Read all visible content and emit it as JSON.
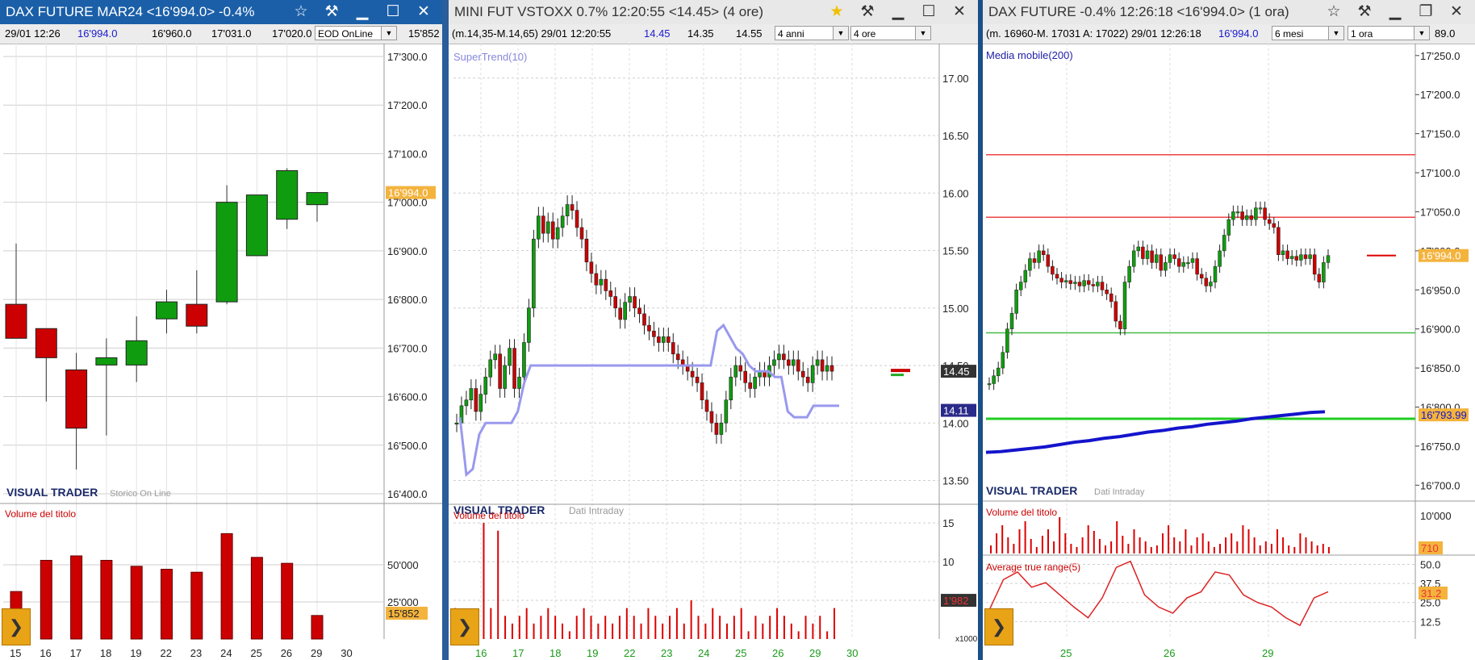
{
  "colors": {
    "up": "#0f9d0f",
    "down": "#cc0000",
    "supertrend": "#9999ee",
    "ma200": "#1414cc",
    "grid": "#cfcfcf",
    "price_tag": "#f3b33d"
  },
  "left": {
    "title": "DAX FUTURE MAR24 <16'994.0> -0.4%",
    "info": {
      "date": "29/01 12:26",
      "last": "16'994.0",
      "v1": "16'960.0",
      "v2": "17'031.0",
      "v3": "17'020.0",
      "source": "EOD OnLine",
      "volume": "15'852"
    },
    "watermark": "VISUAL TRADER",
    "watermark_sub": "Storico On Line",
    "volume_label": "Volume del titolo",
    "price_tag": "16'994.0",
    "volume_tag": "15'852",
    "y_ticks": [
      "17'300.0",
      "17'200.0",
      "17'100.0",
      "17'000.0",
      "16'900.0",
      "16'800.0",
      "16'700.0",
      "16'600.0",
      "16'500.0",
      "16'400.0"
    ],
    "vol_ticks": [
      "50'000",
      "25'000"
    ],
    "x_labels": [
      "15",
      "16",
      "17",
      "18",
      "19",
      "22",
      "23",
      "24",
      "25",
      "26",
      "29",
      "30"
    ],
    "chart_data": {
      "type": "candlestick",
      "categories": [
        "15",
        "16",
        "17",
        "18",
        "19",
        "22",
        "23",
        "24",
        "25",
        "26",
        "29"
      ],
      "open": [
        16790,
        16740,
        16655,
        16665,
        16665,
        16760,
        16790,
        16795,
        16890,
        16965,
        16995
      ],
      "close": [
        16720,
        16680,
        16535,
        16680,
        16715,
        16795,
        16745,
        17000,
        17015,
        17065,
        17020
      ],
      "high": [
        16915,
        16740,
        16690,
        16720,
        16765,
        16820,
        16860,
        17035,
        17015,
        17070,
        17020
      ],
      "low": [
        16720,
        16590,
        16450,
        16520,
        16630,
        16730,
        16730,
        16790,
        16890,
        16945,
        16960
      ],
      "volume": [
        32000,
        53000,
        56000,
        53000,
        49000,
        47000,
        45000,
        71000,
        55000,
        51000,
        15852
      ],
      "ylim": [
        16400,
        17300
      ]
    }
  },
  "middle": {
    "title": "MINI FUT VSTOXX 0.7% 12:20:55 <14.45> (4 ore)",
    "info": {
      "range": "(m.14,35-M.14,65) 29/01 12:20:55",
      "last": "14.45",
      "v1": "14.35",
      "v2": "14.55",
      "period": "4 anni",
      "interval": "4 ore"
    },
    "indicator": "SuperTrend(10)",
    "watermark": "VISUAL TRADER",
    "watermark_sub": "Dati Intraday",
    "volume_label": "Volume del titolo",
    "price_tag": "14.45",
    "st_tag": "14.11",
    "vol_tag": "1'982",
    "vol_unit": "x1000",
    "y_ticks": [
      "17.00",
      "16.50",
      "16.00",
      "15.50",
      "15.00",
      "14.50",
      "14.00",
      "13.50"
    ],
    "vol_ticks": [
      "15",
      "10",
      "5"
    ],
    "x_labels": [
      "16",
      "17",
      "18",
      "19",
      "22",
      "23",
      "24",
      "25",
      "26",
      "29",
      "30"
    ],
    "chart_data": {
      "type": "candlestick",
      "series": [
        {
          "name": "SuperTrend(10)"
        }
      ],
      "close": [
        14.0,
        14.15,
        14.2,
        14.3,
        14.1,
        14.25,
        14.4,
        14.55,
        14.6,
        14.3,
        14.5,
        14.65,
        14.3,
        14.4,
        14.7,
        15.0,
        15.6,
        15.8,
        15.65,
        15.75,
        15.6,
        15.7,
        15.8,
        15.9,
        15.85,
        15.7,
        15.6,
        15.4,
        15.3,
        15.2,
        15.25,
        15.15,
        15.1,
        15.0,
        14.9,
        15.05,
        15.1,
        15.0,
        14.95,
        14.85,
        14.8,
        14.75,
        14.7,
        14.75,
        14.7,
        14.6,
        14.55,
        14.5,
        14.45,
        14.4,
        14.35,
        14.2,
        14.1,
        14.0,
        13.9,
        14.0,
        14.2,
        14.4,
        14.5,
        14.45,
        14.35,
        14.3,
        14.4,
        14.45,
        14.4,
        14.5,
        14.55,
        14.6,
        14.55,
        14.5,
        14.55,
        14.45,
        14.4,
        14.35,
        14.5,
        14.55,
        14.45,
        14.5,
        14.45
      ],
      "supertrend": [
        14.05,
        13.55,
        13.6,
        13.9,
        14.0,
        14.0,
        14.0,
        14.0,
        14.0,
        14.1,
        14.35,
        14.5,
        14.5,
        14.5,
        14.5,
        14.5,
        14.5,
        14.5,
        14.5,
        14.5,
        14.5,
        14.5,
        14.5,
        14.5,
        14.5,
        14.5,
        14.5,
        14.5,
        14.5,
        14.5,
        14.5,
        14.5,
        14.5,
        14.5,
        14.5,
        14.5,
        14.5,
        14.5,
        14.5,
        14.5,
        14.8,
        14.85,
        14.75,
        14.65,
        14.6,
        14.5,
        14.45,
        14.45,
        14.45,
        14.4,
        14.4,
        14.1,
        14.05,
        14.05,
        14.05,
        14.15,
        14.15,
        14.15,
        14.15,
        14.15
      ],
      "volume": [
        4,
        3,
        1,
        2,
        15,
        4,
        14,
        3,
        2,
        3,
        4,
        2,
        3,
        4,
        3,
        2,
        1,
        3,
        4,
        3,
        2,
        3,
        2,
        3,
        4,
        3,
        2,
        4,
        3,
        2,
        3,
        4,
        2,
        5,
        3,
        2,
        4,
        3,
        2,
        3,
        4,
        1,
        3,
        2,
        3,
        4,
        3,
        2,
        1,
        3,
        2,
        3,
        1,
        4
      ],
      "ylim": [
        13.3,
        17.3
      ]
    }
  },
  "right": {
    "title": "DAX FUTURE -0.4% 12:26:18 <16'994.0> (1 ora)",
    "info": {
      "range": "(m. 16960-M. 17031 A: 17022) 29/01 12:26:18",
      "last": "16'994.0",
      "period": "6 mesi",
      "interval": "1 ora",
      "extra": "89.0"
    },
    "indicator": "Media mobile(200)",
    "watermark": "VISUAL TRADER",
    "watermark_sub": "Dati Intraday",
    "volume_label": "Volume del titolo",
    "atr_label": "Average true range(5)",
    "price_tag": "16'994.0",
    "ma_tag": "16'793.99",
    "vol_tag": "710",
    "atr_tag": "31.2",
    "y_ticks": [
      "17'250.0",
      "17'200.0",
      "17'150.0",
      "17'100.0",
      "17'050.0",
      "17'000.0",
      "16'950.0",
      "16'900.0",
      "16'850.0",
      "16'800.0",
      "16'750.0",
      "16'700.0"
    ],
    "vol_ticks": [
      "10'000"
    ],
    "atr_ticks": [
      "50.0",
      "37.5",
      "25.0",
      "12.5"
    ],
    "x_labels": [
      "25",
      "26",
      "29"
    ],
    "hlines": [
      {
        "value": 17123,
        "color": "#ee4444"
      },
      {
        "value": 17043,
        "color": "#ee4444"
      },
      {
        "value": 16895,
        "color": "#44bb44"
      },
      {
        "value": 16785,
        "color": "#22cc22"
      }
    ],
    "chart_data": {
      "type": "candlestick",
      "close": [
        16830,
        16840,
        16850,
        16870,
        16900,
        16920,
        16950,
        16960,
        16975,
        16990,
        16985,
        17000,
        16995,
        16980,
        16970,
        16965,
        16960,
        16962,
        16958,
        16960,
        16955,
        16962,
        16957,
        16955,
        16960,
        16950,
        16945,
        16935,
        16910,
        16900,
        16960,
        16980,
        17000,
        17005,
        16990,
        17000,
        16985,
        16995,
        16975,
        16985,
        16995,
        16990,
        16980,
        16985,
        16985,
        16990,
        16970,
        16965,
        16955,
        16960,
        16980,
        17000,
        17020,
        17040,
        17050,
        17050,
        17040,
        17045,
        17040,
        17055,
        17055,
        17040,
        17035,
        17030,
        16995,
        17000,
        16990,
        16993,
        16988,
        16995,
        16990,
        16995,
        16970,
        16960,
        16985,
        16994
      ],
      "ma200": [
        16742,
        16743,
        16745,
        16747,
        16749,
        16752,
        16755,
        16757,
        16760,
        16762,
        16765,
        16768,
        16770,
        16773,
        16775,
        16778,
        16780,
        16782,
        16785,
        16787,
        16789,
        16791,
        16793,
        16794
      ],
      "atr": [
        20,
        40,
        45,
        35,
        38,
        30,
        22,
        15,
        28,
        48,
        52,
        30,
        22,
        18,
        28,
        32,
        45,
        43,
        30,
        25,
        22,
        15,
        10,
        28,
        32
      ],
      "ylim": [
        16690,
        17255
      ]
    }
  }
}
